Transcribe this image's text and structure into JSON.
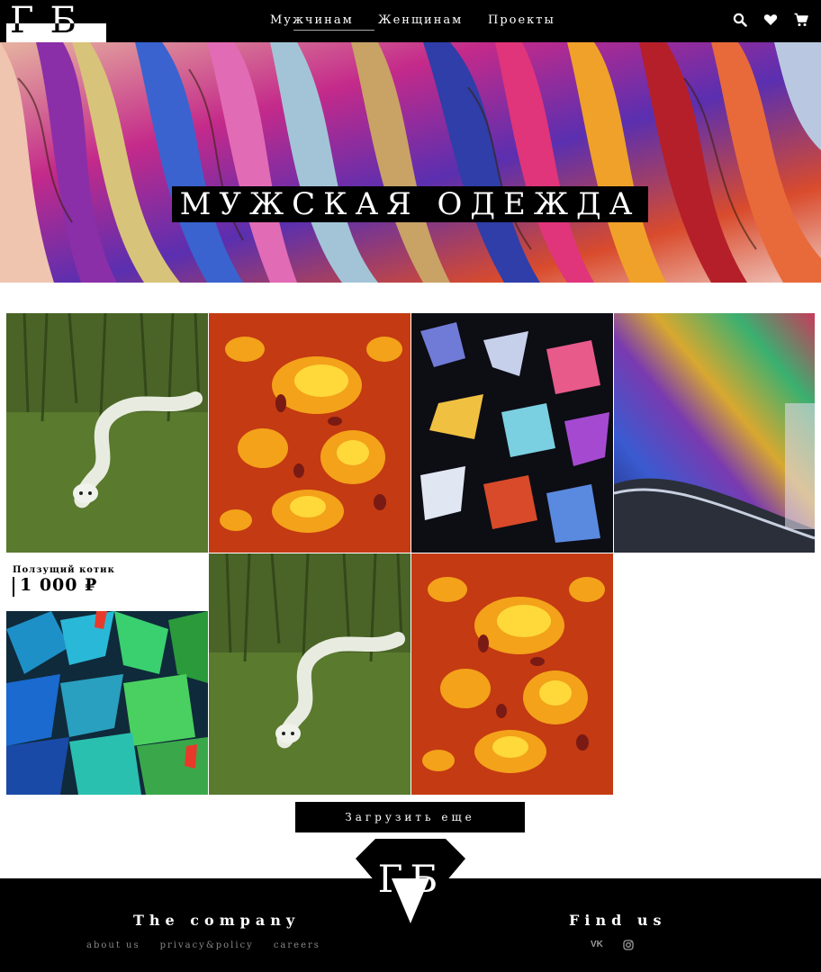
{
  "header": {
    "logo_text": "ГБ",
    "nav": {
      "men": "Мужчинам",
      "women": "Женщинам",
      "projects": "Проекты"
    },
    "icons": [
      "search-icon",
      "heart-icon",
      "cart-icon"
    ]
  },
  "hero": {
    "title": "МУЖСКАЯ ОДЕЖДА"
  },
  "products": [
    {
      "image": "snake-cat"
    },
    {
      "image": "orange-crystals"
    },
    {
      "image": "dark-crystals"
    },
    {
      "image": "rainbow-crystals"
    },
    {
      "image": "blue-green-crystals",
      "name": "Ползущий котик",
      "price": "1 000 ₽"
    },
    {
      "image": "snake-cat"
    },
    {
      "image": "orange-crystals"
    }
  ],
  "load_more": {
    "label": "Загрузить еще"
  },
  "footer": {
    "logo_text": "ГБ",
    "company_heading": "The company",
    "company_links": [
      "about us",
      "privacy&policy",
      "careers"
    ],
    "find_heading": "Find us",
    "social": [
      "vk-icon",
      "instagram-icon"
    ],
    "social_labels": {
      "vk": "VK"
    }
  },
  "colors": {
    "background": "#ffffff",
    "header": "#000000",
    "footer": "#000000",
    "accent_text": "#ffffff",
    "footer_link": "#888888"
  }
}
